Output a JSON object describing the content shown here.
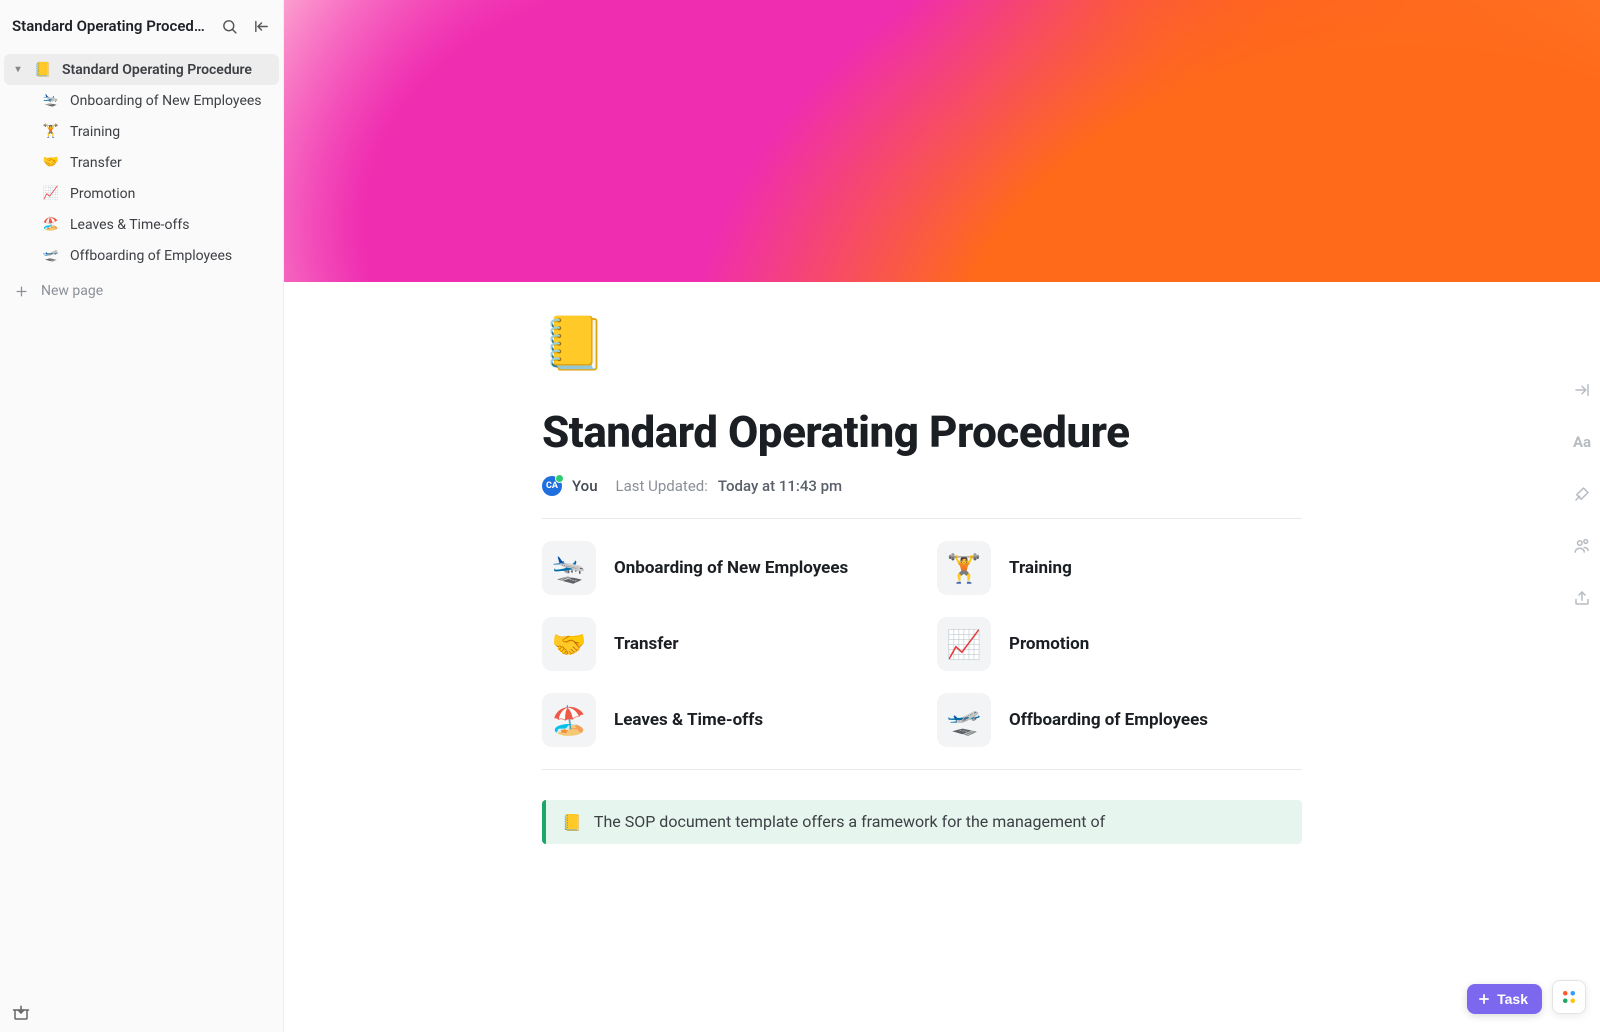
{
  "sidebar": {
    "title": "Standard Operating Procedure",
    "root": {
      "label": "Standard Operating Procedure",
      "icon": "📒"
    },
    "items": [
      {
        "label": "Onboarding of New Employees",
        "icon": "🛬"
      },
      {
        "label": "Training",
        "icon": "🏋️"
      },
      {
        "label": "Transfer",
        "icon": "🤝"
      },
      {
        "label": "Promotion",
        "icon": "📈"
      },
      {
        "label": "Leaves & Time-offs",
        "icon": "🏖️"
      },
      {
        "label": "Offboarding of Employees",
        "icon": "🛫"
      }
    ],
    "new_page": "New page"
  },
  "doc": {
    "icon": "📒",
    "title": "Standard Operating Procedure",
    "avatar_initials": "CA",
    "author": "You",
    "last_updated_label": "Last Updated:",
    "last_updated_value": "Today at 11:43 pm",
    "cards": [
      {
        "label": "Onboarding of New Employees",
        "icon": "🛬"
      },
      {
        "label": "Training",
        "icon": "🏋️"
      },
      {
        "label": "Transfer",
        "icon": "🤝"
      },
      {
        "label": "Promotion",
        "icon": "📈"
      },
      {
        "label": "Leaves & Time-offs",
        "icon": "🏖️"
      },
      {
        "label": "Offboarding of Employees",
        "icon": "🛫"
      }
    ],
    "callout": {
      "icon": "📒",
      "text": "The SOP document template offers a framework for the management of"
    }
  },
  "rail": {
    "font_label": "Aa"
  },
  "task_button": "Task"
}
